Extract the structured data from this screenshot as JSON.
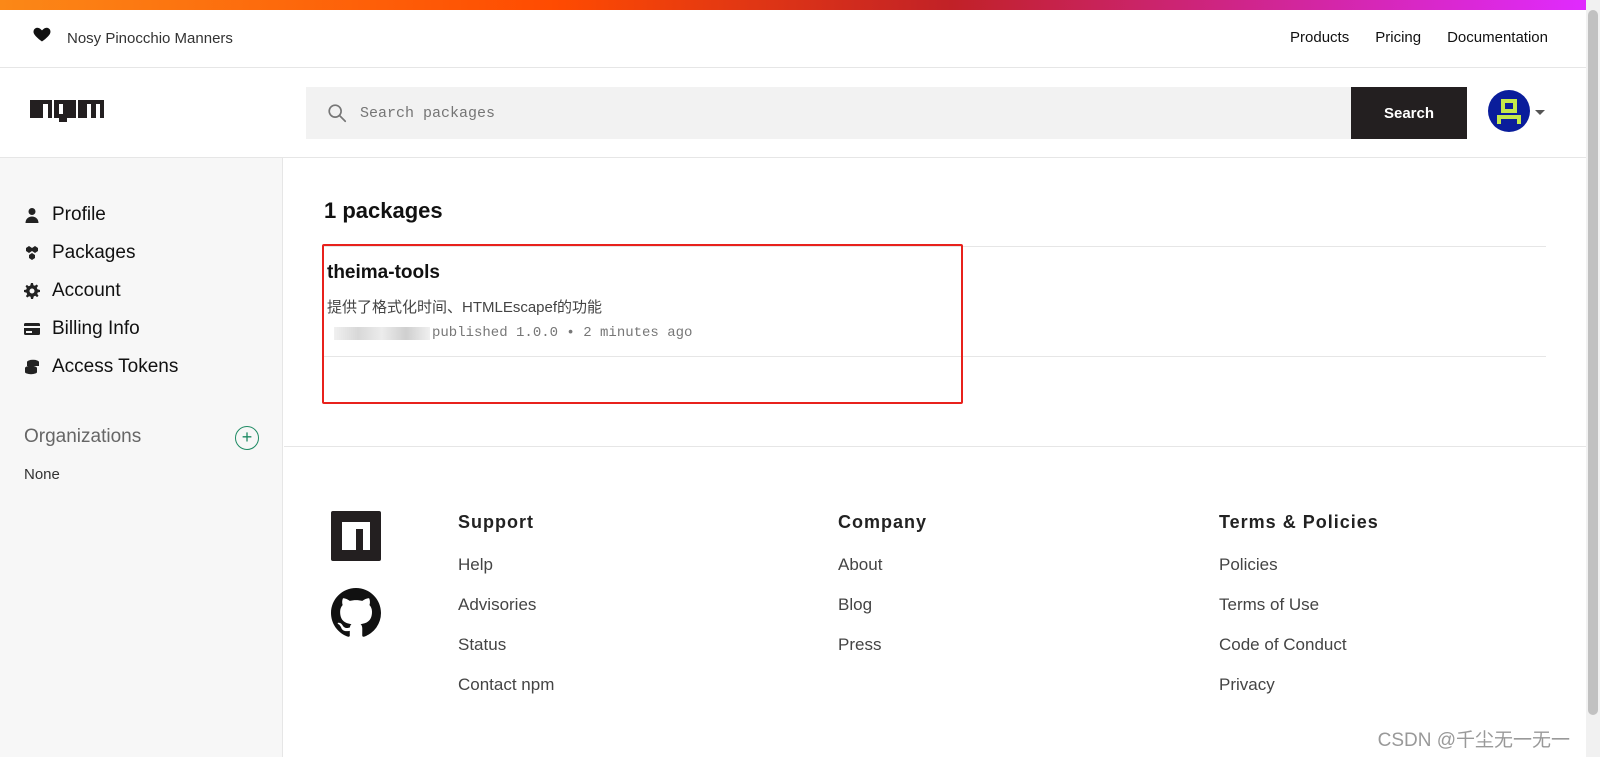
{
  "header": {
    "user_name": "Nosy Pinocchio Manners",
    "nav": [
      "Products",
      "Pricing",
      "Documentation"
    ]
  },
  "search": {
    "placeholder": "Search packages",
    "button_label": "Search"
  },
  "sidebar": {
    "items": [
      {
        "label": "Profile",
        "icon": "user-icon"
      },
      {
        "label": "Packages",
        "icon": "packages-icon"
      },
      {
        "label": "Account",
        "icon": "gear-icon"
      },
      {
        "label": "Billing Info",
        "icon": "credit-card-icon"
      },
      {
        "label": "Access Tokens",
        "icon": "coins-icon"
      }
    ],
    "organizations_title": "Organizations",
    "organizations_add": "+",
    "organizations_value": "None"
  },
  "main": {
    "package_count": "1 packages",
    "packages": [
      {
        "name": "theima-tools",
        "description": "提供了格式化时间、HTMLEscapef的功能",
        "meta": "published 1.0.0 • 2 minutes ago"
      }
    ]
  },
  "footer": {
    "columns": [
      {
        "title": "Support",
        "links": [
          "Help",
          "Advisories",
          "Status",
          "Contact npm"
        ]
      },
      {
        "title": "Company",
        "links": [
          "About",
          "Blog",
          "Press"
        ]
      },
      {
        "title": "Terms & Policies",
        "links": [
          "Policies",
          "Terms of Use",
          "Code of Conduct",
          "Privacy"
        ]
      }
    ]
  },
  "watermark": "CSDN @千尘无一无一",
  "colors": {
    "highlight": "#e8211c",
    "brand_dark": "#231f20",
    "org_add": "#1e8a63"
  }
}
